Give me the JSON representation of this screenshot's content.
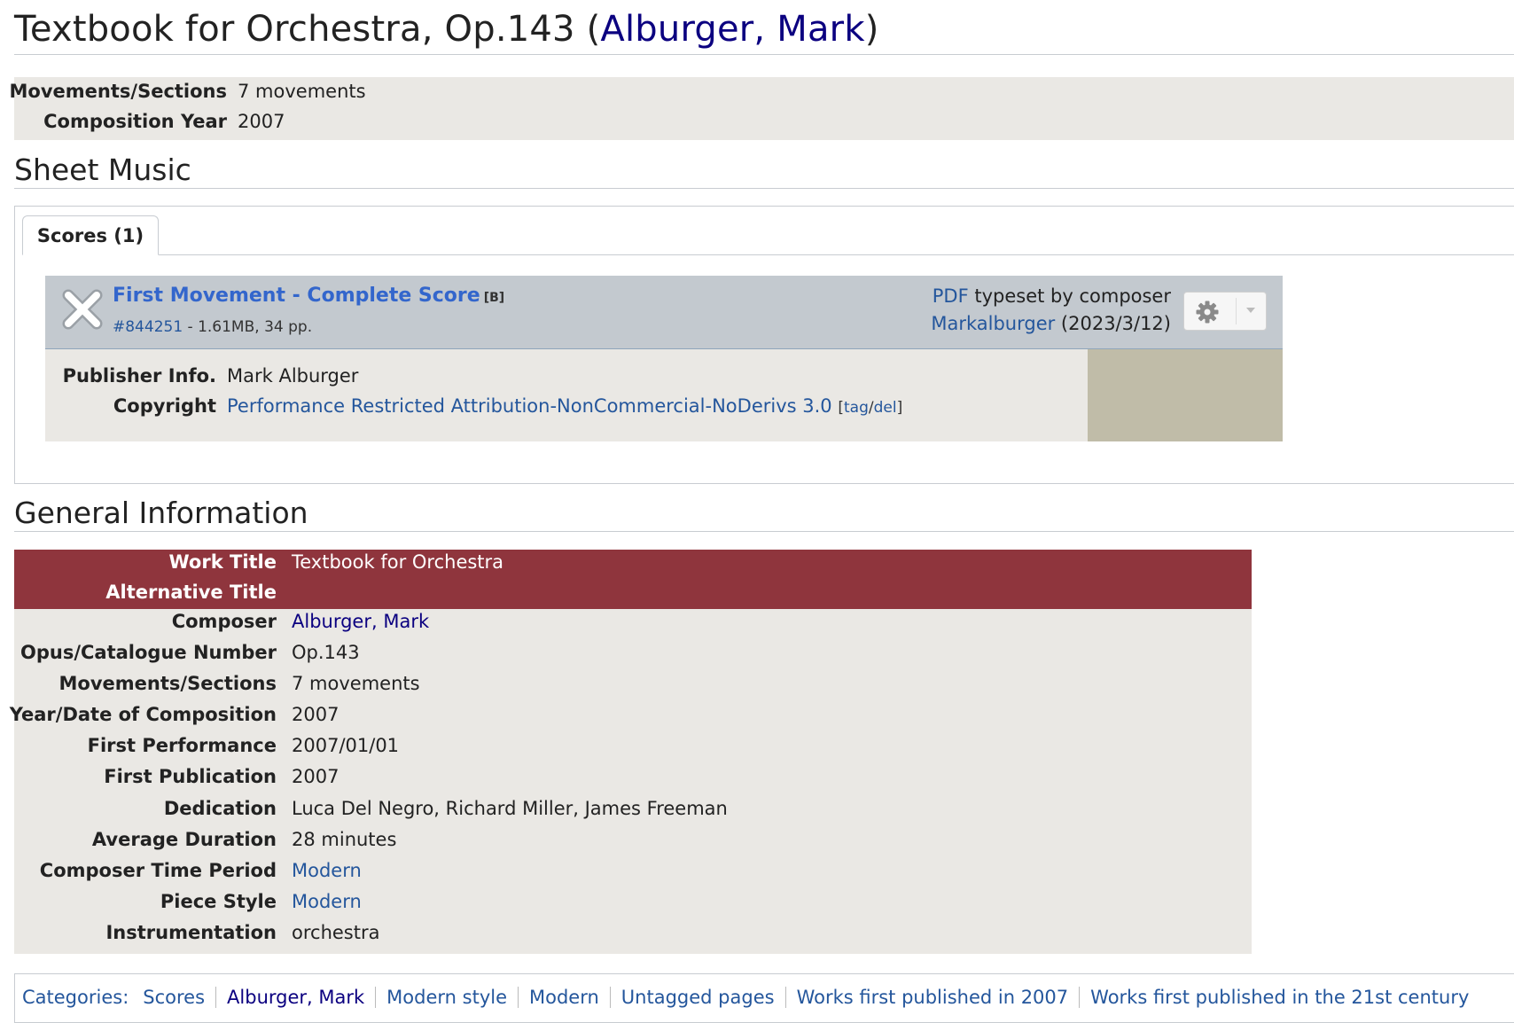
{
  "page": {
    "title": "Textbook for Orchestra, Op.143",
    "title_open": " (",
    "composer_link": "Alburger, Mark",
    "title_close": ")"
  },
  "summary": {
    "rows": [
      {
        "label": "Movements/Sections",
        "value": "7 movements"
      },
      {
        "label": "Composition Year",
        "value": "2007"
      }
    ]
  },
  "sheet_music": {
    "heading": "Sheet Music",
    "tab_label": "Scores (1)",
    "file": {
      "title": "First Movement - Complete Score",
      "badge": "[B]",
      "id": "#844251",
      "meta": " - 1.61MB, 34 pp.",
      "format": "PDF",
      "source": " typeset by composer",
      "uploader": "Markalburger",
      "date": " (2023/3/12)",
      "publisher_label": "Publisher Info.",
      "publisher_value": "Mark Alburger",
      "copyright_label": "Copyright",
      "copyright_value": "Performance Restricted Attribution-NonCommercial-NoDerivs 3.0",
      "bracket_open": "[",
      "tag": "tag",
      "slash": "/",
      "del": "del",
      "bracket_close": "]"
    }
  },
  "general": {
    "heading": "General Information",
    "rows": [
      {
        "label": "Work Title",
        "value": "Textbook for Orchestra"
      },
      {
        "label": "Alternative Title",
        "value": ""
      },
      {
        "label": "Composer",
        "value": "Alburger, Mark"
      },
      {
        "label": "Opus/Catalogue Number",
        "value": "Op.143"
      },
      {
        "label": "Movements/Sections",
        "value": "7 movements"
      },
      {
        "label": "Year/Date of Composition",
        "value": "2007"
      },
      {
        "label": "First Performance",
        "value": "2007/01/01"
      },
      {
        "label": "First Publication",
        "value": "2007"
      },
      {
        "label": "Dedication",
        "value": "Luca Del Negro, Richard Miller, James Freeman"
      },
      {
        "label": "Average Duration",
        "value": "28 minutes"
      },
      {
        "label": "Composer Time Period",
        "value": "Modern"
      },
      {
        "label": "Piece Style",
        "value": "Modern"
      },
      {
        "label": "Instrumentation",
        "value": "orchestra"
      }
    ]
  },
  "categories": {
    "label": "Categories:",
    "items": [
      "Scores",
      "Alburger, Mark",
      "Modern style",
      "Modern",
      "Untagged pages",
      "Works first published in 2007",
      "Works first published in the 21st century"
    ]
  },
  "colors": {
    "header_band": "#8f353d",
    "table_bg": "#eae8e4",
    "file_header": "#c3c9cf",
    "link": "#24569c"
  }
}
